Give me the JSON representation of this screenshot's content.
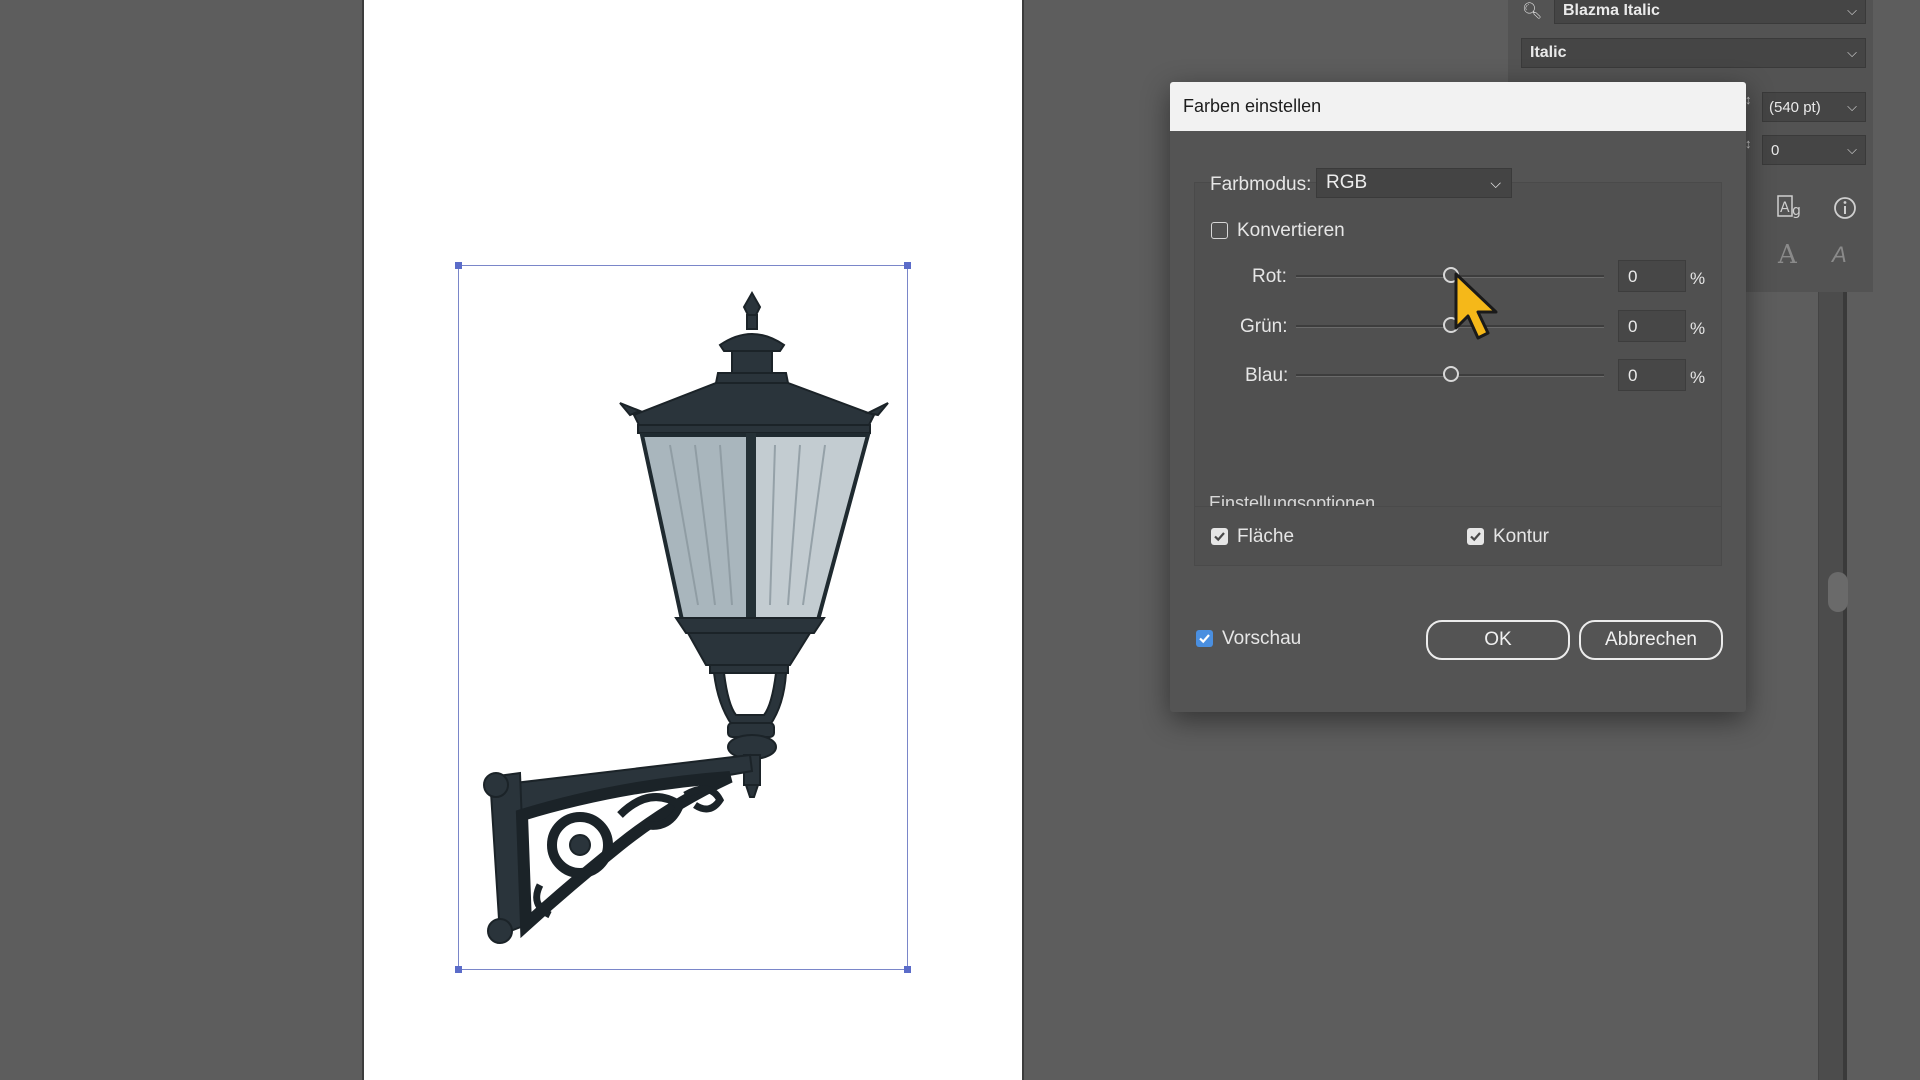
{
  "panel": {
    "font_family": "Blazma Italic",
    "font_style": "Italic",
    "font_size": "(540 pt)",
    "tracking": "0"
  },
  "dialog": {
    "title": "Farben einstellen",
    "mode_label": "Farbmodus:",
    "mode_value": "RGB",
    "convert_label": "Konvertieren",
    "convert_checked": false,
    "sliders": [
      {
        "label": "Rot:",
        "value": "0",
        "unit": "%"
      },
      {
        "label": "Grün:",
        "value": "0",
        "unit": "%"
      },
      {
        "label": "Blau:",
        "value": "0",
        "unit": "%"
      }
    ],
    "options_title": "Einstellungsoptionen",
    "fill_label": "Fläche",
    "fill_checked": true,
    "stroke_label": "Kontur",
    "stroke_checked": true,
    "preview_label": "Vorschau",
    "preview_checked": true,
    "ok_label": "OK",
    "cancel_label": "Abbrechen"
  },
  "colors": {
    "workspace": "#5d5d5d",
    "dialog_bg": "#545454",
    "title_bar": "#f2f2f2",
    "selection": "#5b6cc9",
    "checkbox_blue": "#4a8fe0",
    "cursor": "#f5b819"
  }
}
